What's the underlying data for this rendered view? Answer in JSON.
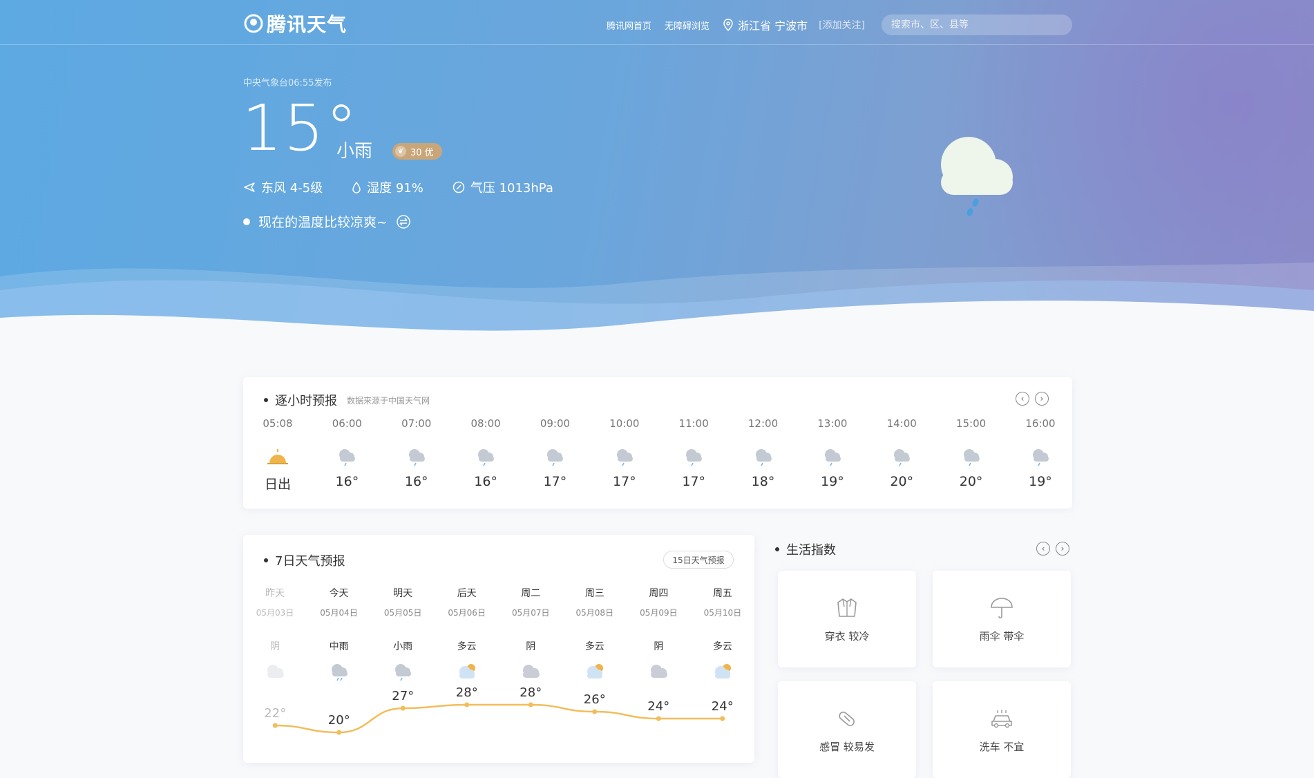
{
  "header": {
    "brand": "腾讯天气",
    "nav": [
      "腾讯网首页",
      "无障碍浏览"
    ],
    "location": "浙江省 宁波市",
    "follow": "[添加关注]",
    "search_placeholder": "搜索市、区、县等"
  },
  "current": {
    "publish": "中央气象台06:55发布",
    "temp": "15°",
    "condition": "小雨",
    "aqi": "30 优",
    "wind": "东风 4-5级",
    "humidity": "湿度 91%",
    "pressure": "气压 1013hPa",
    "tip": "现在的温度比较凉爽~"
  },
  "hourly": {
    "title": "逐小时预报",
    "source": "数据来源于中国天气网",
    "items": [
      {
        "time": "05:08",
        "temp": "日出",
        "icon": "sunrise-icon"
      },
      {
        "time": "06:00",
        "temp": "16°",
        "icon": "light-rain-icon"
      },
      {
        "time": "07:00",
        "temp": "16°",
        "icon": "light-rain-icon"
      },
      {
        "time": "08:00",
        "temp": "16°",
        "icon": "light-rain-icon"
      },
      {
        "time": "09:00",
        "temp": "17°",
        "icon": "light-rain-icon"
      },
      {
        "time": "10:00",
        "temp": "17°",
        "icon": "light-rain-icon"
      },
      {
        "time": "11:00",
        "temp": "17°",
        "icon": "light-rain-icon"
      },
      {
        "time": "12:00",
        "temp": "18°",
        "icon": "light-rain-icon"
      },
      {
        "time": "13:00",
        "temp": "19°",
        "icon": "light-rain-icon"
      },
      {
        "time": "14:00",
        "temp": "20°",
        "icon": "light-rain-icon"
      },
      {
        "time": "15:00",
        "temp": "20°",
        "icon": "light-rain-icon"
      },
      {
        "time": "16:00",
        "temp": "19°",
        "icon": "light-rain-icon"
      }
    ]
  },
  "daily": {
    "title": "7日天气预报",
    "button": "15日天气预报",
    "items": [
      {
        "day": "昨天",
        "date": "05月03日",
        "cond": "阴",
        "high": 22,
        "high_label": "22°",
        "icon": "overcast-icon",
        "past": true
      },
      {
        "day": "今天",
        "date": "05月04日",
        "cond": "中雨",
        "high": 20,
        "high_label": "20°",
        "icon": "moderate-rain-icon",
        "past": false
      },
      {
        "day": "明天",
        "date": "05月05日",
        "cond": "小雨",
        "high": 27,
        "high_label": "27°",
        "icon": "light-rain-icon",
        "past": false
      },
      {
        "day": "后天",
        "date": "05月06日",
        "cond": "多云",
        "high": 28,
        "high_label": "28°",
        "icon": "partly-cloudy-icon",
        "past": false
      },
      {
        "day": "周二",
        "date": "05月07日",
        "cond": "阴",
        "high": 28,
        "high_label": "28°",
        "icon": "overcast-icon",
        "past": false
      },
      {
        "day": "周三",
        "date": "05月08日",
        "cond": "多云",
        "high": 26,
        "high_label": "26°",
        "icon": "partly-cloudy-icon",
        "past": false
      },
      {
        "day": "周四",
        "date": "05月09日",
        "cond": "阴",
        "high": 24,
        "high_label": "24°",
        "icon": "overcast-icon",
        "past": false
      },
      {
        "day": "周五",
        "date": "05月10日",
        "cond": "多云",
        "high": 24,
        "high_label": "24°",
        "icon": "partly-cloudy-icon",
        "past": false
      }
    ]
  },
  "life": {
    "title": "生活指数",
    "items": [
      {
        "label": "穿衣 较冷",
        "icon": "jacket-icon"
      },
      {
        "label": "雨伞 带伞",
        "icon": "umbrella-icon"
      },
      {
        "label": "感冒 较易发",
        "icon": "pill-icon"
      },
      {
        "label": "洗车 不宜",
        "icon": "car-icon"
      }
    ]
  },
  "colors": {
    "high_line": "#f2bd5a",
    "low_line": "#7db8ec",
    "aqi_badge": "#c9a679"
  }
}
